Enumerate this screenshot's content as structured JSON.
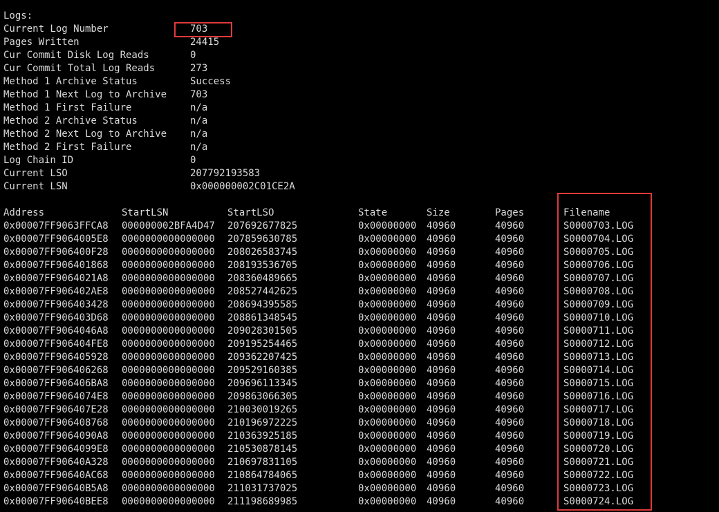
{
  "title": "Logs:",
  "summary": [
    {
      "key": "Current Log Number",
      "value": "703"
    },
    {
      "key": "Pages Written",
      "value": "24415"
    },
    {
      "key": "Cur Commit Disk Log Reads",
      "value": "0"
    },
    {
      "key": "Cur Commit Total Log Reads",
      "value": "273"
    },
    {
      "key": "Method 1 Archive Status",
      "value": "Success"
    },
    {
      "key": "Method 1 Next Log to Archive",
      "value": "703"
    },
    {
      "key": "Method 1 First Failure",
      "value": "n/a"
    },
    {
      "key": "Method 2 Archive Status",
      "value": "n/a"
    },
    {
      "key": "Method 2 Next Log to Archive",
      "value": "n/a"
    },
    {
      "key": "Method 2 First Failure",
      "value": "n/a"
    },
    {
      "key": "Log Chain ID",
      "value": "0"
    },
    {
      "key": "Current LSO",
      "value": "207792193583"
    },
    {
      "key": "Current LSN",
      "value": "0x000000002C01CE2A"
    }
  ],
  "table": {
    "headers": [
      "Address",
      "StartLSN",
      "StartLSO",
      "State",
      "Size",
      "Pages",
      "Filename"
    ],
    "rows": [
      [
        "0x00007FF9063FFCA8",
        "000000002BFA4D47",
        "207692677825",
        "0x00000000",
        "40960",
        "40960",
        "S0000703.LOG"
      ],
      [
        "0x00007FF9064005E8",
        "0000000000000000",
        "207859630785",
        "0x00000000",
        "40960",
        "40960",
        "S0000704.LOG"
      ],
      [
        "0x00007FF906400F28",
        "0000000000000000",
        "208026583745",
        "0x00000000",
        "40960",
        "40960",
        "S0000705.LOG"
      ],
      [
        "0x00007FF906401868",
        "0000000000000000",
        "208193536705",
        "0x00000000",
        "40960",
        "40960",
        "S0000706.LOG"
      ],
      [
        "0x00007FF9064021A8",
        "0000000000000000",
        "208360489665",
        "0x00000000",
        "40960",
        "40960",
        "S0000707.LOG"
      ],
      [
        "0x00007FF906402AE8",
        "0000000000000000",
        "208527442625",
        "0x00000000",
        "40960",
        "40960",
        "S0000708.LOG"
      ],
      [
        "0x00007FF906403428",
        "0000000000000000",
        "208694395585",
        "0x00000000",
        "40960",
        "40960",
        "S0000709.LOG"
      ],
      [
        "0x00007FF906403D68",
        "0000000000000000",
        "208861348545",
        "0x00000000",
        "40960",
        "40960",
        "S0000710.LOG"
      ],
      [
        "0x00007FF9064046A8",
        "0000000000000000",
        "209028301505",
        "0x00000000",
        "40960",
        "40960",
        "S0000711.LOG"
      ],
      [
        "0x00007FF906404FE8",
        "0000000000000000",
        "209195254465",
        "0x00000000",
        "40960",
        "40960",
        "S0000712.LOG"
      ],
      [
        "0x00007FF906405928",
        "0000000000000000",
        "209362207425",
        "0x00000000",
        "40960",
        "40960",
        "S0000713.LOG"
      ],
      [
        "0x00007FF906406268",
        "0000000000000000",
        "209529160385",
        "0x00000000",
        "40960",
        "40960",
        "S0000714.LOG"
      ],
      [
        "0x00007FF906406BA8",
        "0000000000000000",
        "209696113345",
        "0x00000000",
        "40960",
        "40960",
        "S0000715.LOG"
      ],
      [
        "0x00007FF9064074E8",
        "0000000000000000",
        "209863066305",
        "0x00000000",
        "40960",
        "40960",
        "S0000716.LOG"
      ],
      [
        "0x00007FF906407E28",
        "0000000000000000",
        "210030019265",
        "0x00000000",
        "40960",
        "40960",
        "S0000717.LOG"
      ],
      [
        "0x00007FF906408768",
        "0000000000000000",
        "210196972225",
        "0x00000000",
        "40960",
        "40960",
        "S0000718.LOG"
      ],
      [
        "0x00007FF9064090A8",
        "0000000000000000",
        "210363925185",
        "0x00000000",
        "40960",
        "40960",
        "S0000719.LOG"
      ],
      [
        "0x00007FF9064099E8",
        "0000000000000000",
        "210530878145",
        "0x00000000",
        "40960",
        "40960",
        "S0000720.LOG"
      ],
      [
        "0x00007FF90640A328",
        "0000000000000000",
        "210697831105",
        "0x00000000",
        "40960",
        "40960",
        "S0000721.LOG"
      ],
      [
        "0x00007FF90640AC68",
        "0000000000000000",
        "210864784065",
        "0x00000000",
        "40960",
        "40960",
        "S0000722.LOG"
      ],
      [
        "0x00007FF90640B5A8",
        "0000000000000000",
        "211031737025",
        "0x00000000",
        "40960",
        "40960",
        "S0000723.LOG"
      ],
      [
        "0x00007FF90640BEE8",
        "0000000000000000",
        "211198689985",
        "0x00000000",
        "40960",
        "40960",
        "S0000724.LOG"
      ]
    ]
  },
  "colors": {
    "background": "#000000",
    "text": "#d9d9d9",
    "highlight": "#e03a3a"
  }
}
